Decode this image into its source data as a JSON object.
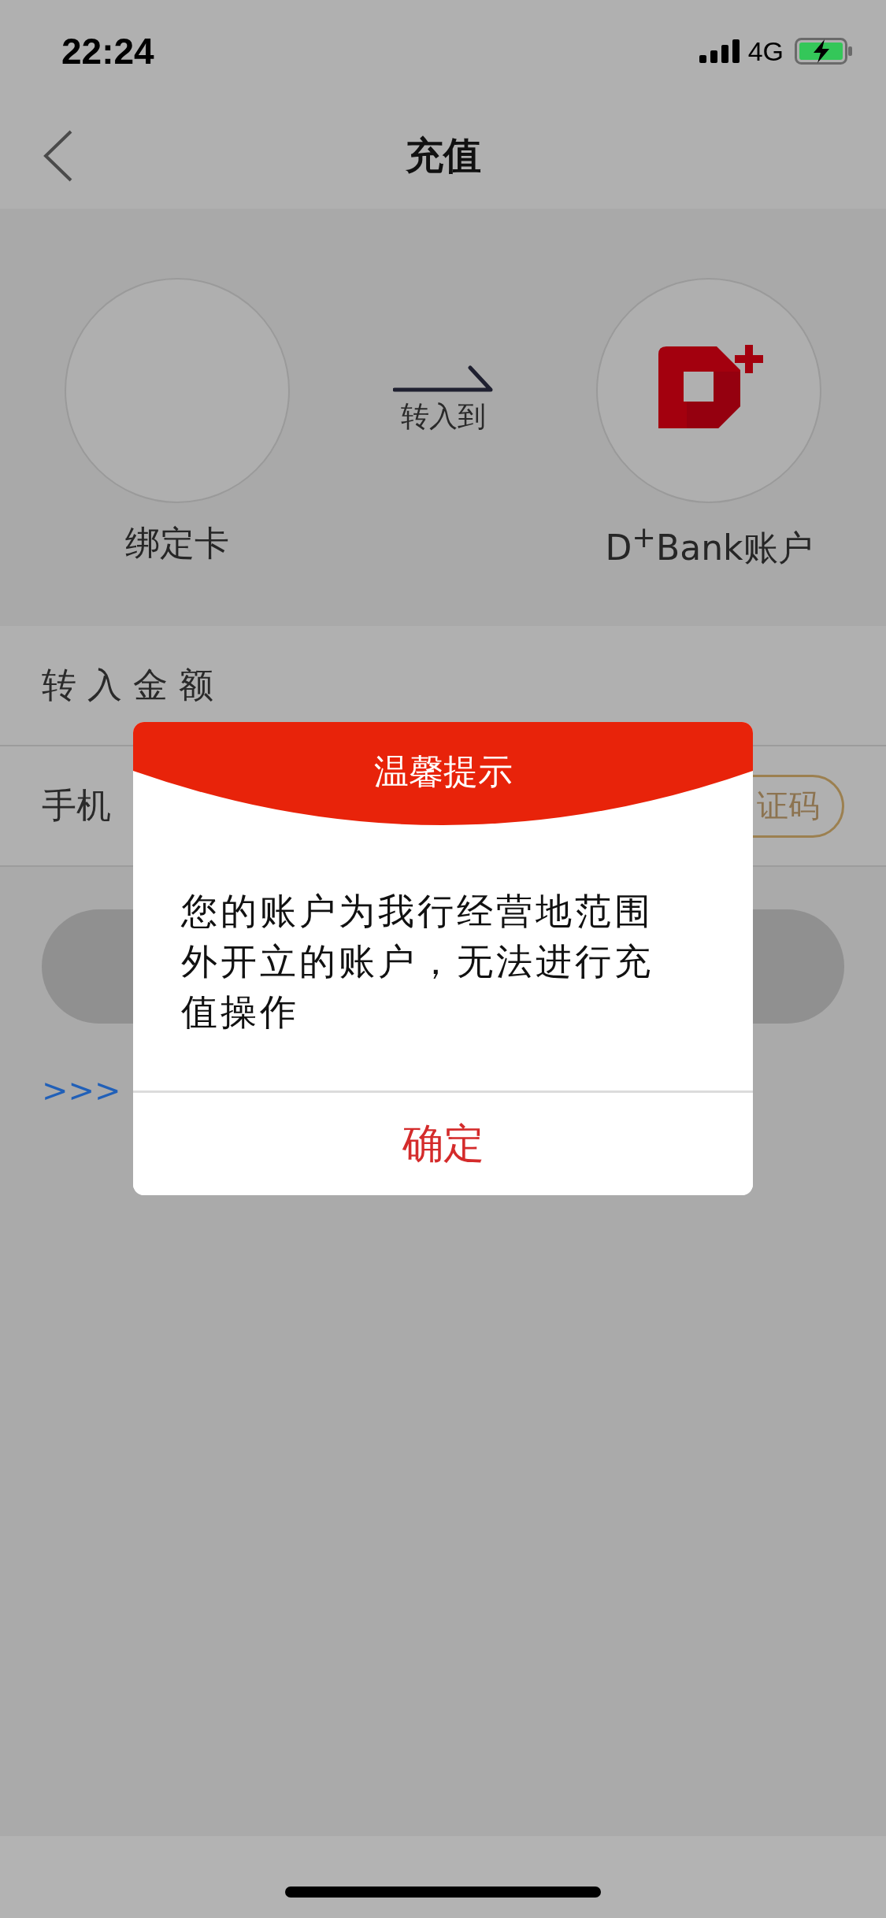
{
  "status_bar": {
    "time": "22:24",
    "network": "4G"
  },
  "nav": {
    "title": "充值"
  },
  "transfer": {
    "from_label": "绑定卡",
    "arrow_label": "转入到",
    "to_label": "D$^{+}$Bank账户"
  },
  "form": {
    "rows": [
      {
        "label": "转 入 金 额"
      },
      {
        "label": "手机",
        "button": "证码"
      }
    ]
  },
  "link": ">>>",
  "dialog": {
    "title": "温馨提示",
    "message": "您的账户为我行经营地范围外开立的账户，无法进行充值操作",
    "button": "确定"
  }
}
